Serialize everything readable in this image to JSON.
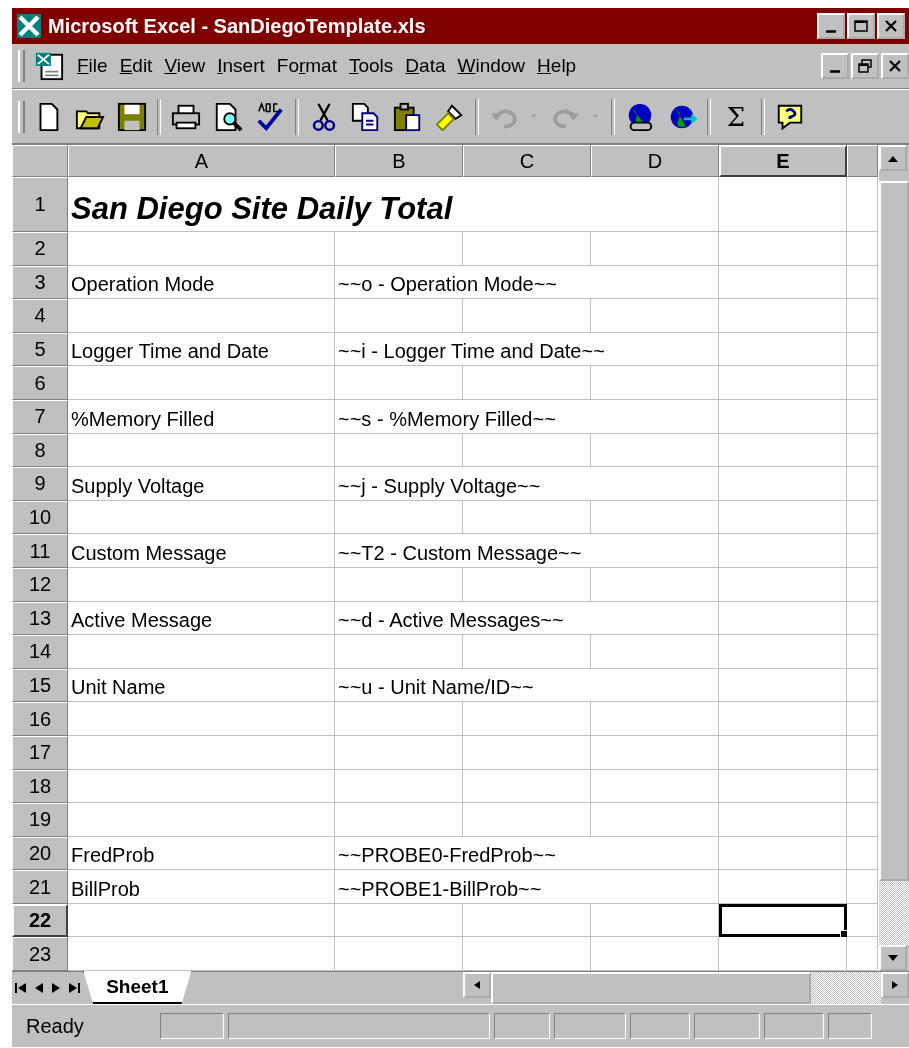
{
  "window": {
    "title": "Microsoft Excel - SanDiegoTemplate.xls"
  },
  "menu": [
    {
      "key": "F",
      "post": "ile"
    },
    {
      "key": "E",
      "post": "dit"
    },
    {
      "key": "V",
      "post": "iew"
    },
    {
      "key": "I",
      "post": "nsert"
    },
    {
      "pre": "Fo",
      "key": "r",
      "post": "mat"
    },
    {
      "key": "T",
      "post": "ools"
    },
    {
      "key": "D",
      "post": "ata"
    },
    {
      "key": "W",
      "post": "indow"
    },
    {
      "key": "H",
      "post": "elp"
    }
  ],
  "toolbar": [
    {
      "kind": "new",
      "disabled": false
    },
    {
      "kind": "open",
      "disabled": false
    },
    {
      "kind": "save",
      "disabled": false
    },
    {
      "kind": "separator"
    },
    {
      "kind": "print",
      "disabled": false
    },
    {
      "kind": "preview",
      "disabled": false
    },
    {
      "kind": "spelling",
      "disabled": false
    },
    {
      "kind": "separator"
    },
    {
      "kind": "cut",
      "disabled": false
    },
    {
      "kind": "copy",
      "disabled": false
    },
    {
      "kind": "paste",
      "disabled": false
    },
    {
      "kind": "painter",
      "disabled": false
    },
    {
      "kind": "separator"
    },
    {
      "kind": "undo",
      "disabled": true
    },
    {
      "kind": "dropdown",
      "disabled": true
    },
    {
      "kind": "redo",
      "disabled": true
    },
    {
      "kind": "dropdown",
      "disabled": true
    },
    {
      "kind": "separator"
    },
    {
      "kind": "web",
      "disabled": false
    },
    {
      "kind": "globe",
      "disabled": false
    },
    {
      "kind": "separator"
    },
    {
      "kind": "sum",
      "label": "Σ",
      "disabled": false
    },
    {
      "kind": "separator"
    },
    {
      "kind": "help",
      "disabled": false
    }
  ],
  "columns": [
    {
      "label": "A",
      "selected": false
    },
    {
      "label": "B",
      "selected": false
    },
    {
      "label": "C",
      "selected": false
    },
    {
      "label": "D",
      "selected": false
    },
    {
      "label": "E",
      "selected": true
    }
  ],
  "rows": [
    {
      "number": "1",
      "selected": false,
      "title": "San Diego Site Daily Total"
    },
    {
      "number": "2",
      "selected": false
    },
    {
      "number": "3",
      "selected": false,
      "a": "Operation Mode",
      "b": "~~o - Operation Mode~~"
    },
    {
      "number": "4",
      "selected": false
    },
    {
      "number": "5",
      "selected": false,
      "a": "Logger Time and Date",
      "b": "~~i - Logger Time and Date~~"
    },
    {
      "number": "6",
      "selected": false
    },
    {
      "number": "7",
      "selected": false,
      "a": "%Memory Filled",
      "b": "~~s - %Memory Filled~~"
    },
    {
      "number": "8",
      "selected": false
    },
    {
      "number": "9",
      "selected": false,
      "a": "Supply Voltage",
      "b": "~~j - Supply Voltage~~"
    },
    {
      "number": "10",
      "selected": false
    },
    {
      "number": "11",
      "selected": false,
      "a": "Custom Message",
      "b": "~~T2 - Custom Message~~"
    },
    {
      "number": "12",
      "selected": false
    },
    {
      "number": "13",
      "selected": false,
      "a": "Active Message",
      "b": "~~d - Active Messages~~"
    },
    {
      "number": "14",
      "selected": false
    },
    {
      "number": "15",
      "selected": false,
      "a": "Unit Name",
      "b": "~~u - Unit Name/ID~~"
    },
    {
      "number": "16",
      "selected": false
    },
    {
      "number": "17",
      "selected": false
    },
    {
      "number": "18",
      "selected": false
    },
    {
      "number": "19",
      "selected": false
    },
    {
      "number": "20",
      "selected": false,
      "a": "FredProb",
      "b": "~~PROBE0-FredProb~~"
    },
    {
      "number": "21",
      "selected": false,
      "a": "BillProb",
      "b": "~~PROBE1-BillProb~~"
    },
    {
      "number": "22",
      "selected": true
    },
    {
      "number": "23",
      "selected": false
    }
  ],
  "sheet_tabs": [
    {
      "label": "Sheet1",
      "selected": true
    }
  ],
  "status_bar": {
    "text": "Ready"
  }
}
